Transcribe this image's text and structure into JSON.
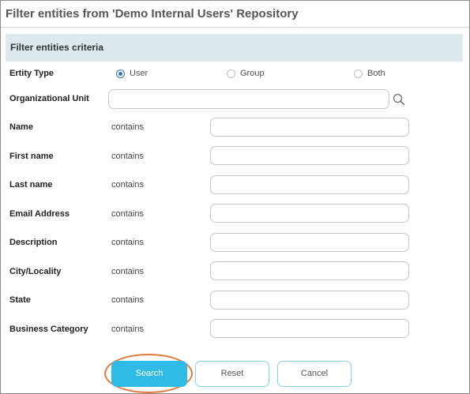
{
  "dialog": {
    "title": "Filter entities from 'Demo Internal Users' Repository",
    "section_title": "Filter entities criteria"
  },
  "entity_type": {
    "label": "Ertity Type",
    "options": [
      {
        "label": "User",
        "selected": true
      },
      {
        "label": "Group",
        "selected": false
      },
      {
        "label": "Both",
        "selected": false
      }
    ]
  },
  "org_unit": {
    "label": "Organizational Unit",
    "value": ""
  },
  "criteria": [
    {
      "label": "Name",
      "operator": "contains",
      "value": ""
    },
    {
      "label": "First name",
      "operator": "contains",
      "value": ""
    },
    {
      "label": "Last name",
      "operator": "contains",
      "value": ""
    },
    {
      "label": "Email Address",
      "operator": "contains",
      "value": ""
    },
    {
      "label": "Description",
      "operator": "contains",
      "value": ""
    },
    {
      "label": "City/Locality",
      "operator": "contains",
      "value": ""
    },
    {
      "label": "State",
      "operator": "contains",
      "value": ""
    },
    {
      "label": "Business Category",
      "operator": "contains",
      "value": ""
    }
  ],
  "buttons": {
    "search": "Search",
    "reset": "Reset",
    "cancel": "Cancel"
  },
  "colors": {
    "header_band": "#dde9ec",
    "primary_button": "#2fbbe6",
    "radio_selected": "#2f73b7",
    "highlight_ring": "#e07a3a"
  },
  "icons": {
    "org_unit_lookup": "search-icon"
  }
}
